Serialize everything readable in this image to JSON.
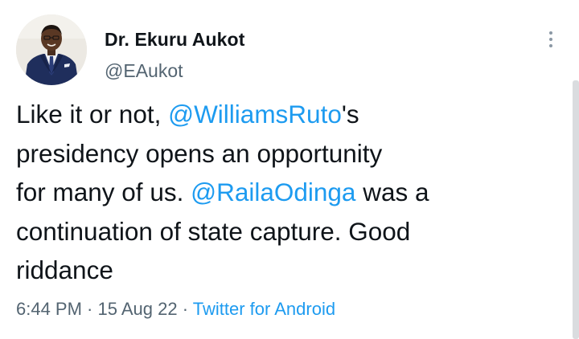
{
  "author": {
    "name": "Dr. Ekuru Aukot",
    "handle": "@EAukot"
  },
  "tweet": {
    "line1_pre": "Like it or not, ",
    "mention1": "@WilliamsRuto",
    "line1_post": "'s",
    "line2": "presidency opens an opportunity",
    "line3_pre": "for many of us. ",
    "mention2": "@RailaOdinga",
    "line3_post": " was a",
    "line4": "continuation of state capture. Good",
    "line5": "riddance"
  },
  "meta": {
    "time": "6:44 PM",
    "separator": " · ",
    "date": "15 Aug 22",
    "source": "Twitter for Android"
  },
  "icons": {
    "more": "more-vertical-icon"
  },
  "colors": {
    "link": "#1d9bf0",
    "secondary_text": "#536471",
    "primary_text": "#0f1419"
  }
}
